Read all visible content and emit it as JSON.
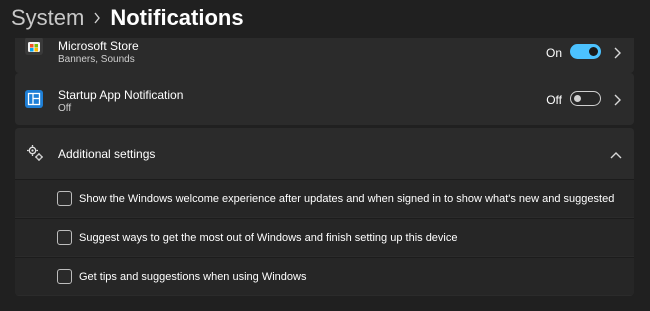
{
  "breadcrumb": {
    "parent": "System",
    "current": "Notifications"
  },
  "apps": [
    {
      "name": "Microsoft Store",
      "subtitle": "Banners, Sounds",
      "state_label": "On",
      "enabled": true,
      "icon": "microsoft-store-icon"
    },
    {
      "name": "Startup App Notification",
      "subtitle": "Off",
      "state_label": "Off",
      "enabled": false,
      "icon": "startup-app-icon"
    }
  ],
  "additional_settings": {
    "title": "Additional settings",
    "icon": "gear-icon",
    "expanded": true,
    "options": [
      {
        "label": "Show the Windows welcome experience after updates and when signed in to show what's new and suggested",
        "checked": false
      },
      {
        "label": "Suggest ways to get the most out of Windows and finish setting up this device",
        "checked": false
      },
      {
        "label": "Get tips and suggestions when using Windows",
        "checked": false
      }
    ]
  },
  "colors": {
    "background": "#202020",
    "card": "#2b2b2b",
    "accent": "#4cc2ff"
  }
}
